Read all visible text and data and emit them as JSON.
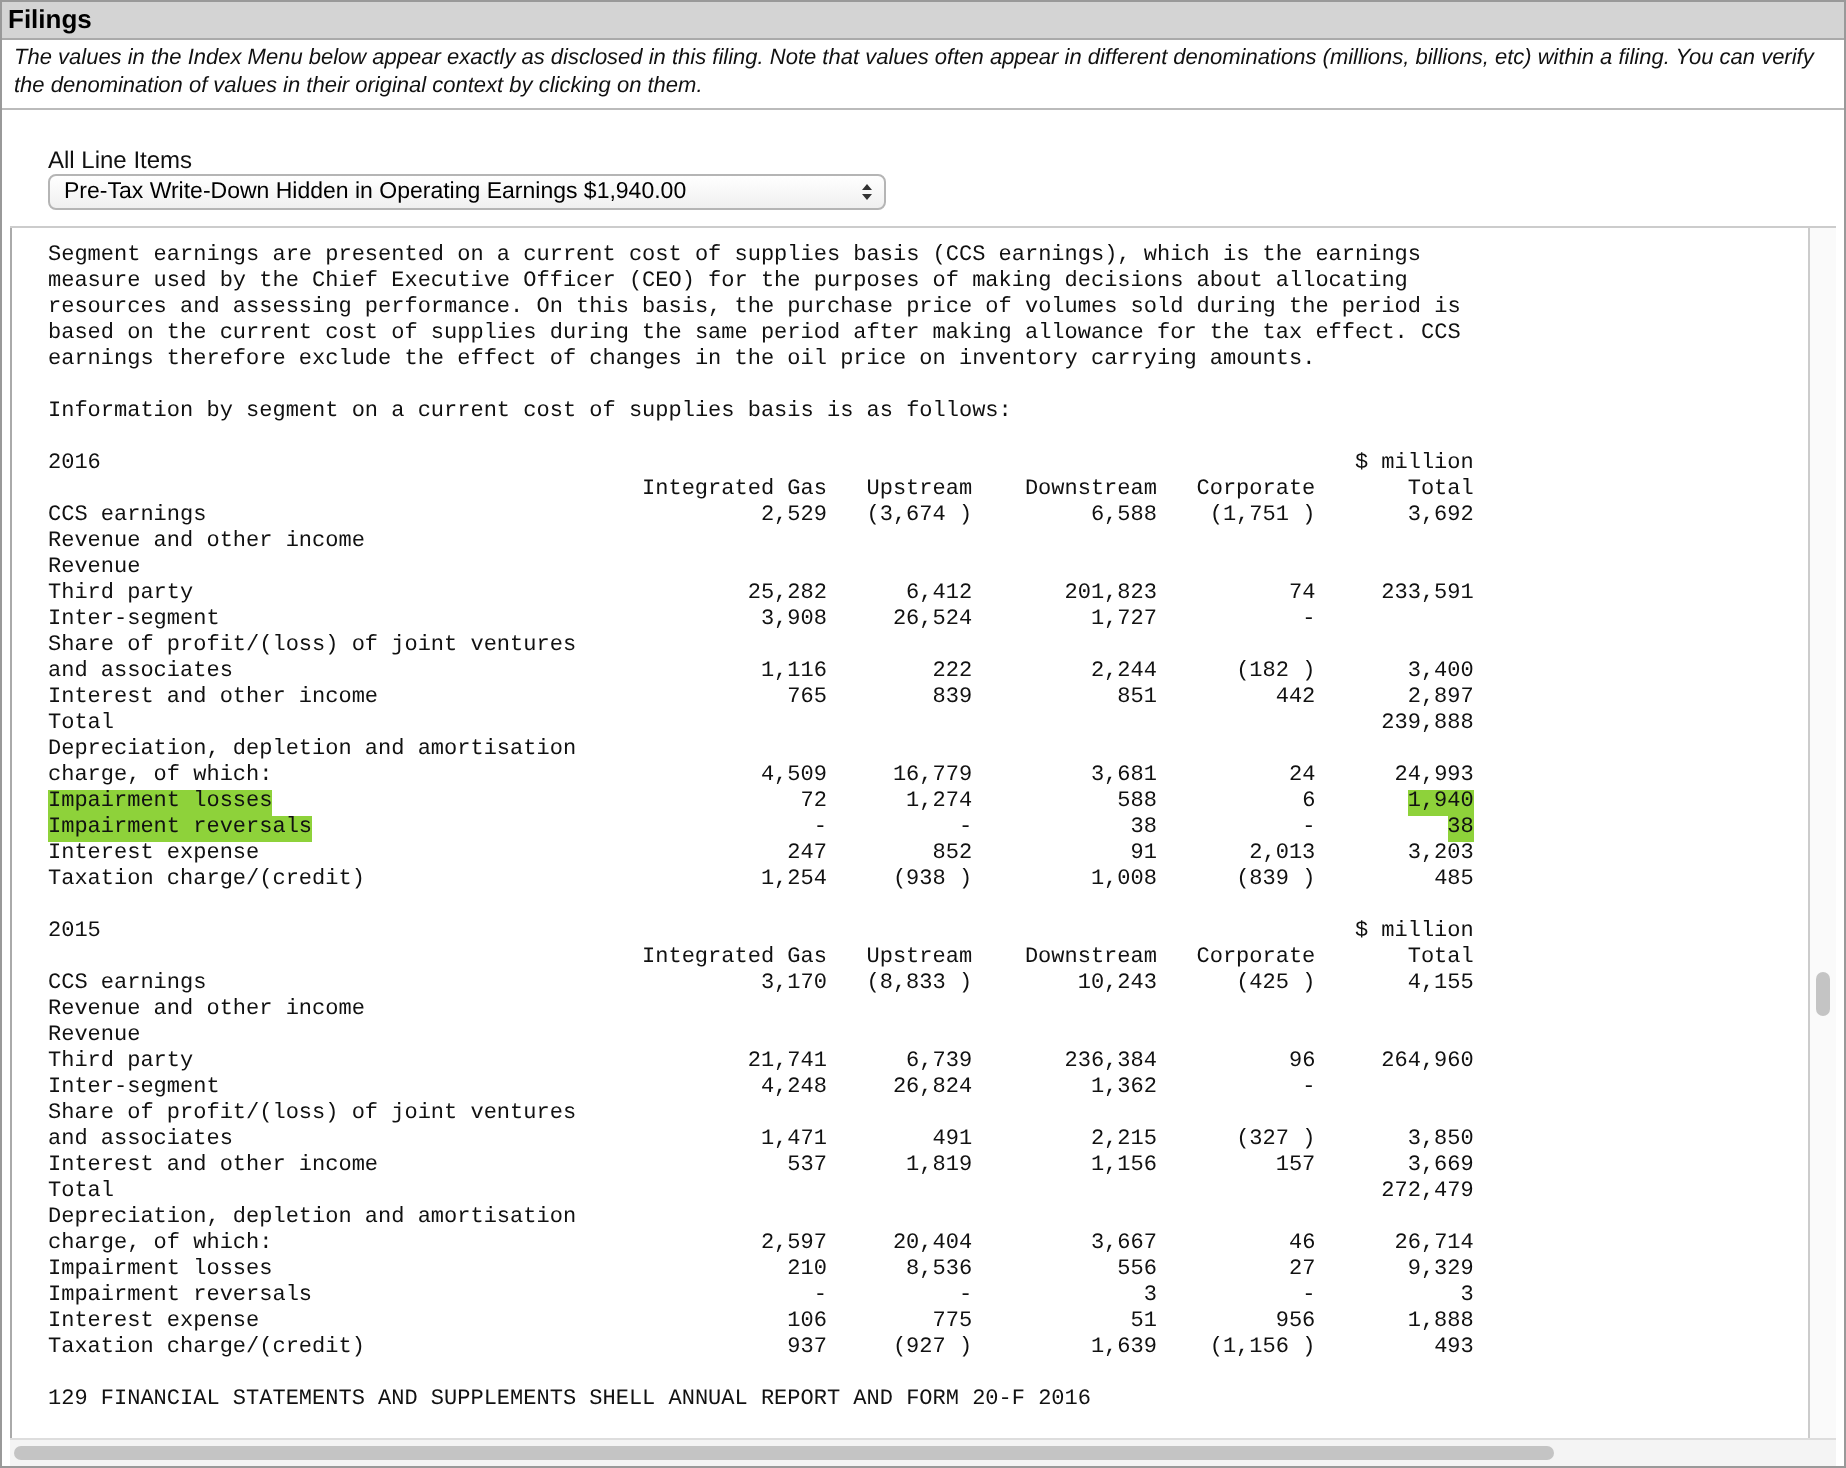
{
  "panel": {
    "title": "Filings",
    "note": "The values in the Index Menu below appear exactly as disclosed in this filing. Note that values often appear in different denominations (millions, billions, etc) within a filing. You can verify the denomination of values in their original context by clicking on them."
  },
  "selector": {
    "label": "All Line Items",
    "value": "Pre-Tax Write-Down Hidden in Operating Earnings $1,940.00"
  },
  "document": {
    "paragraph": "Segment earnings are presented on a current cost of supplies basis (CCS earnings), which is the earnings measure used by the Chief Executive Officer (CEO) for the purposes of making decisions about allocating resources and assessing performance. On this basis, the purchase price of volumes sold during the period is based on the current cost of supplies during the same period after making allowance for the tax effect. CCS earnings therefore exclude the effect of changes in the oil price on inventory carrying amounts.",
    "intro": "Information by segment on a current cost of supplies basis is as follows:",
    "sections": [
      {
        "year": "2016",
        "unit": "$ million",
        "columns": {
          "integrated_gas": "Integrated Gas",
          "upstream": "Upstream",
          "downstream": "Downstream",
          "corporate": "Corporate",
          "total": "Total"
        },
        "rows": [
          {
            "label": "CCS earnings",
            "integrated_gas": "2,529",
            "upstream": "(3,674 )",
            "downstream": "6,588",
            "corporate": "(1,751 )",
            "total": "3,692",
            "highlighted": false
          },
          {
            "label": "Revenue and other income",
            "highlighted": false
          },
          {
            "label": "Revenue",
            "highlighted": false
          },
          {
            "label": "Third party",
            "integrated_gas": "25,282",
            "upstream": "6,412",
            "downstream": "201,823",
            "corporate": "74",
            "total": "233,591",
            "highlighted": false
          },
          {
            "label": "Inter-segment",
            "integrated_gas": "3,908",
            "upstream": "26,524",
            "downstream": "1,727",
            "corporate": "-",
            "highlighted": false
          },
          {
            "label": "Share of profit/(loss) of joint ventures",
            "highlighted": false
          },
          {
            "label": "and associates",
            "integrated_gas": "1,116",
            "upstream": "222",
            "downstream": "2,244",
            "corporate": "(182 )",
            "total": "3,400",
            "highlighted": false
          },
          {
            "label": "Interest and other income",
            "integrated_gas": "765",
            "upstream": "839",
            "downstream": "851",
            "corporate": "442",
            "total": "2,897",
            "highlighted": false
          },
          {
            "label": "Total",
            "total": "239,888",
            "highlighted": false
          },
          {
            "label": "Depreciation, depletion and amortisation",
            "highlighted": false
          },
          {
            "label": "charge, of which:",
            "integrated_gas": "4,509",
            "upstream": "16,779",
            "downstream": "3,681",
            "corporate": "24",
            "total": "24,993",
            "highlighted": false
          },
          {
            "label": "Impairment losses",
            "integrated_gas": "72",
            "upstream": "1,274",
            "downstream": "588",
            "corporate": "6",
            "total": "1,940",
            "highlighted": true
          },
          {
            "label": "Impairment reversals",
            "integrated_gas": "-",
            "upstream": "-",
            "downstream": "38",
            "corporate": "-",
            "total": "38",
            "highlighted": true
          },
          {
            "label": "Interest expense",
            "integrated_gas": "247",
            "upstream": "852",
            "downstream": "91",
            "corporate": "2,013",
            "total": "3,203",
            "highlighted": false
          },
          {
            "label": "Taxation charge/(credit)",
            "integrated_gas": "1,254",
            "upstream": "(938 )",
            "downstream": "1,008",
            "corporate": "(839 )",
            "total": "485",
            "highlighted": false
          }
        ]
      },
      {
        "year": "2015",
        "unit": "$ million",
        "columns": {
          "integrated_gas": "Integrated Gas",
          "upstream": "Upstream",
          "downstream": "Downstream",
          "corporate": "Corporate",
          "total": "Total"
        },
        "rows": [
          {
            "label": "CCS earnings",
            "integrated_gas": "3,170",
            "upstream": "(8,833 )",
            "downstream": "10,243",
            "corporate": "(425 )",
            "total": "4,155",
            "highlighted": false
          },
          {
            "label": "Revenue and other income",
            "highlighted": false
          },
          {
            "label": "Revenue",
            "highlighted": false
          },
          {
            "label": "Third party",
            "integrated_gas": "21,741",
            "upstream": "6,739",
            "downstream": "236,384",
            "corporate": "96",
            "total": "264,960",
            "highlighted": false
          },
          {
            "label": "Inter-segment",
            "integrated_gas": "4,248",
            "upstream": "26,824",
            "downstream": "1,362",
            "corporate": "-",
            "highlighted": false
          },
          {
            "label": "Share of profit/(loss) of joint ventures",
            "highlighted": false
          },
          {
            "label": "and associates",
            "integrated_gas": "1,471",
            "upstream": "491",
            "downstream": "2,215",
            "corporate": "(327 )",
            "total": "3,850",
            "highlighted": false
          },
          {
            "label": "Interest and other income",
            "integrated_gas": "537",
            "upstream": "1,819",
            "downstream": "1,156",
            "corporate": "157",
            "total": "3,669",
            "highlighted": false
          },
          {
            "label": "Total",
            "total": "272,479",
            "highlighted": false
          },
          {
            "label": "Depreciation, depletion and amortisation",
            "highlighted": false
          },
          {
            "label": "charge, of which:",
            "integrated_gas": "2,597",
            "upstream": "20,404",
            "downstream": "3,667",
            "corporate": "46",
            "total": "26,714",
            "highlighted": false
          },
          {
            "label": "Impairment losses",
            "integrated_gas": "210",
            "upstream": "8,536",
            "downstream": "556",
            "corporate": "27",
            "total": "9,329",
            "highlighted": false
          },
          {
            "label": "Impairment reversals",
            "integrated_gas": "-",
            "upstream": "-",
            "downstream": "3",
            "corporate": "-",
            "total": "3",
            "highlighted": false
          },
          {
            "label": "Interest expense",
            "integrated_gas": "106",
            "upstream": "775",
            "downstream": "51",
            "corporate": "956",
            "total": "1,888",
            "highlighted": false
          },
          {
            "label": "Taxation charge/(credit)",
            "integrated_gas": "937",
            "upstream": "(927 )",
            "downstream": "1,639",
            "corporate": "(1,156 )",
            "total": "493",
            "highlighted": false
          }
        ]
      }
    ],
    "footer": "129 FINANCIAL STATEMENTS AND SUPPLEMENTS SHELL ANNUAL REPORT AND FORM 20-F 2016"
  }
}
